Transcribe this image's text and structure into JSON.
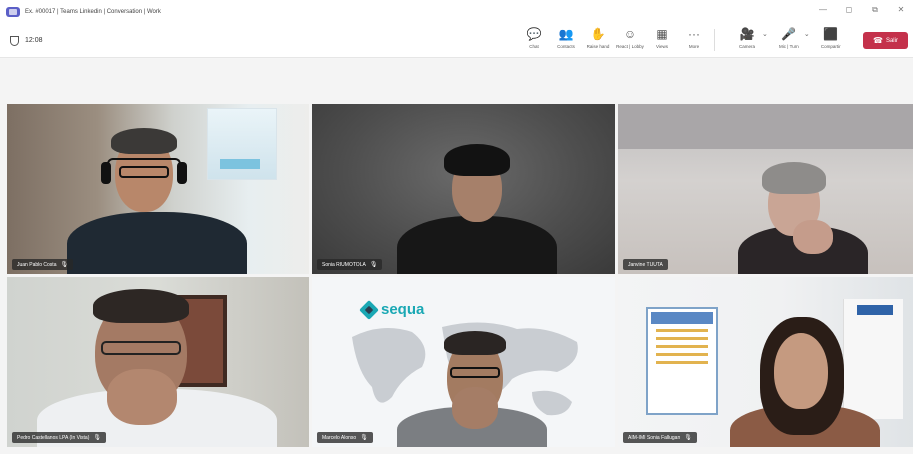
{
  "window": {
    "title": "Ex. #00017 | Teams Linkedin | Conversation | Work",
    "controls": [
      "—",
      "◻",
      "⧉",
      "✕"
    ]
  },
  "meeting": {
    "timer": "12:08"
  },
  "toolbar": {
    "tools": [
      {
        "icon": "chat-icon",
        "glyph": "💬",
        "label": "Chat"
      },
      {
        "icon": "people-icon",
        "glyph": "👥",
        "label": "Contacts"
      },
      {
        "icon": "raise-hand-icon",
        "glyph": "✋",
        "label": "Raise hand"
      },
      {
        "icon": "react-icon",
        "glyph": "☺",
        "label": "React | Lobby"
      },
      {
        "icon": "view-icon",
        "glyph": "▦",
        "label": "Views"
      },
      {
        "icon": "more-icon",
        "glyph": "···",
        "label": "More"
      }
    ],
    "media": [
      {
        "icon": "camera-icon",
        "glyph": "🎥",
        "label": "Camera"
      },
      {
        "icon": "mic-icon",
        "glyph": "🎤",
        "label": "Mic | Turn"
      },
      {
        "icon": "share-icon",
        "glyph": "⬛",
        "label": "Compartir"
      }
    ],
    "leave": {
      "icon": "phone-icon",
      "glyph": "☎",
      "label": "Salir"
    }
  },
  "participants": [
    {
      "name": "Juan Pablo Costa"
    },
    {
      "name": "Sonia RIUMOTOLA"
    },
    {
      "name": "Janvine TUUTA"
    },
    {
      "name": "Pedro Castellanos LPA (In Vista)"
    },
    {
      "name": "Marcelo Alonso"
    },
    {
      "name": "AIM-IMI Sonia Fallugan"
    }
  ],
  "slide": {
    "logo_text": "sequa"
  },
  "colors": {
    "accent": "#5b5fc7",
    "leave": "#c4314b",
    "brand_sequa": "#1aa8b4"
  }
}
